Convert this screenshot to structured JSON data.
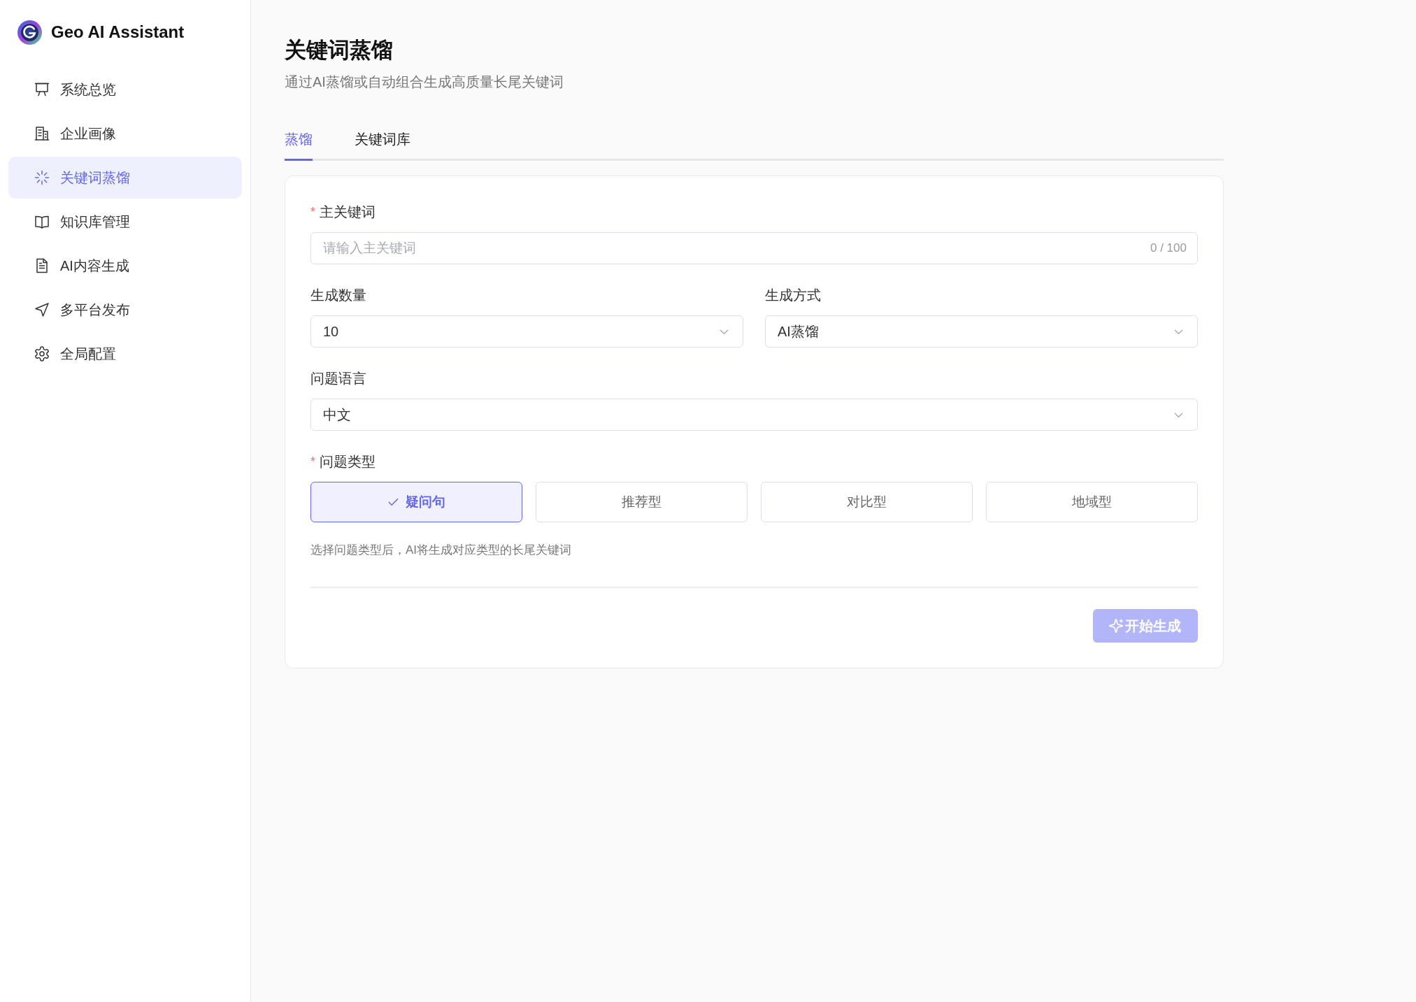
{
  "sidebar": {
    "brand": "Geo AI Assistant",
    "items": [
      {
        "label": "系统总览",
        "selected": false
      },
      {
        "label": "企业画像",
        "selected": false
      },
      {
        "label": "关键词蒸馏",
        "selected": true
      },
      {
        "label": "知识库管理",
        "selected": false
      },
      {
        "label": "AI内容生成",
        "selected": false
      },
      {
        "label": "多平台发布",
        "selected": false
      },
      {
        "label": "全局配置",
        "selected": false
      }
    ]
  },
  "header": {
    "title": "关键词蒸馏",
    "subtitle": "通过AI蒸馏或自动组合生成高质量长尾关键词"
  },
  "tabs": [
    {
      "label": "蒸馏",
      "selected": true
    },
    {
      "label": "关键词库",
      "selected": false
    }
  ],
  "form": {
    "main_keyword": {
      "required_mark": "*",
      "label": "主关键词",
      "placeholder": "请输入主关键词",
      "counter": "0 / 100"
    },
    "count": {
      "label": "生成数量",
      "value": "10"
    },
    "method": {
      "label": "生成方式",
      "value": "AI蒸馏"
    },
    "language": {
      "label": "问题语言",
      "value": "中文"
    },
    "question_type": {
      "required_mark": "*",
      "label": "问题类型",
      "options": [
        {
          "label": "疑问句",
          "selected": true
        },
        {
          "label": "推荐型",
          "selected": false
        },
        {
          "label": "对比型",
          "selected": false
        },
        {
          "label": "地域型",
          "selected": false
        }
      ],
      "hint": "选择问题类型后，AI将生成对应类型的长尾关键词"
    },
    "submit": {
      "label": "开始生成",
      "disabled": true
    }
  }
}
